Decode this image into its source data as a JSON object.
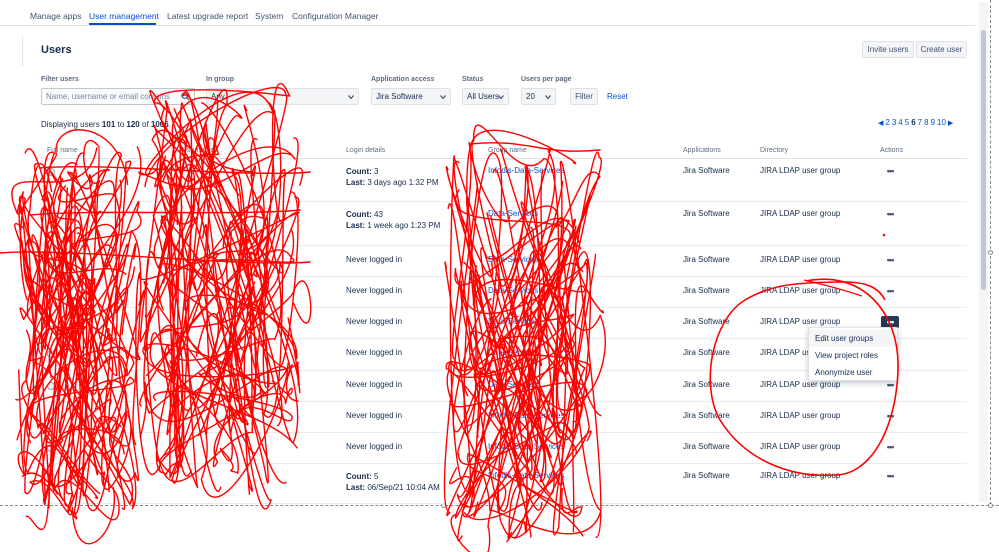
{
  "nav": {
    "tabs": [
      {
        "label": "Manage apps"
      },
      {
        "label": "User management"
      },
      {
        "label": "Latest upgrade report"
      },
      {
        "label": "System"
      },
      {
        "label": "Configuration Manager"
      }
    ]
  },
  "page": {
    "title": "Users",
    "invite_label": "Invite users",
    "create_label": "Create user"
  },
  "filters": {
    "filter_users_label": "Filter users",
    "filter_users_placeholder": "Name, username or email contains",
    "in_group_label": "In group",
    "in_group_value": "Any",
    "app_access_label": "Application access",
    "app_access_value": "Jira Software",
    "status_label": "Status",
    "status_value": "All Users",
    "per_page_label": "Users per page",
    "per_page_value": "20",
    "filter_button": "Filter",
    "reset_link": "Reset"
  },
  "summary": {
    "prefix": "Displaying users ",
    "from": "101",
    "to_word": " to ",
    "to": "120",
    "of_word": " of ",
    "total": "1006",
    "suffix": "."
  },
  "pagination": {
    "pages": [
      "2",
      "3",
      "4",
      "5",
      "6",
      "7",
      "8",
      "9",
      "10"
    ],
    "current": "6"
  },
  "table": {
    "headers": {
      "full_name": "Full name",
      "username": "Username",
      "login": "Login details",
      "group": "Group name",
      "applications": "Applications",
      "directory": "Directory",
      "actions": "Actions"
    },
    "rows": [
      {
        "full_name": "",
        "username": "",
        "count_label": "Count: ",
        "count": "3",
        "last_label": "Last: ",
        "last": "3 days ago 1:32 PM",
        "never": "",
        "group": "Infodis-Data-Services",
        "app": "Jira Software",
        "dir": "JIRA LDAP user group",
        "actions": "•••"
      },
      {
        "full_name": "",
        "username": "",
        "count_label": "Count: ",
        "count": "43",
        "last_label": "Last: ",
        "last": "1 week ago 1:23 PM",
        "never": "",
        "group": "Data-Services",
        "app": "Jira Software",
        "dir": "JIRA LDAP user group",
        "actions": "•••"
      },
      {
        "full_name": "",
        "username": "",
        "count_label": "",
        "count": "",
        "last_label": "",
        "last": "",
        "never": "Never logged in",
        "group": "Data-Services",
        "app": "Jira Software",
        "dir": "JIRA LDAP user group",
        "actions": "•••"
      },
      {
        "full_name": "",
        "username": "",
        "count_label": "",
        "count": "",
        "last_label": "",
        "last": "",
        "never": "Never logged in",
        "group": "Data-Services",
        "app": "Jira Software",
        "dir": "JIRA LDAP user group",
        "actions": "•••"
      },
      {
        "full_name": "",
        "username": "",
        "count_label": "",
        "count": "",
        "last_label": "",
        "last": "",
        "never": "Never logged in",
        "group": "Data-Services",
        "app": "Jira Software",
        "dir": "JIRA LDAP user group",
        "actions": "•••"
      },
      {
        "full_name": "",
        "username": "",
        "count_label": "",
        "count": "",
        "last_label": "",
        "last": "",
        "never": "Never logged in",
        "group": "Data-Services",
        "app": "Jira Software",
        "dir": "JIRA LDAP user group",
        "actions": "•••"
      },
      {
        "full_name": "",
        "username": "",
        "count_label": "",
        "count": "",
        "last_label": "",
        "last": "",
        "never": "Never logged in",
        "group": "Data-Services",
        "app": "Jira Software",
        "dir": "JIRA LDAP user group",
        "actions": "•••"
      },
      {
        "full_name": "",
        "username": "",
        "count_label": "",
        "count": "",
        "last_label": "",
        "last": "",
        "never": "Never logged in",
        "group": "Infodis-Data-Services",
        "app": "Jira Software",
        "dir": "JIRA LDAP user group",
        "actions": "•••"
      },
      {
        "full_name": "",
        "username": "",
        "count_label": "",
        "count": "",
        "last_label": "",
        "last": "",
        "never": "Never logged in",
        "group": "Infodis-Data-Services",
        "app": "Jira Software",
        "dir": "JIRA LDAP user group",
        "actions": "•••"
      },
      {
        "full_name": "",
        "username": "",
        "count_label": "Count: ",
        "count": "5",
        "last_label": "Last: ",
        "last": "06/Sep/21 10:04 AM",
        "never": "",
        "group": "Infodis-Data-Services",
        "app": "Jira Software",
        "dir": "JIRA LDAP user group",
        "actions": "•••"
      }
    ]
  },
  "action_menu": {
    "items": [
      "Edit user groups",
      "View project roles",
      "Anonymize user"
    ]
  },
  "colors": {
    "accent": "#0052cc",
    "annotation": "#ff0000"
  }
}
